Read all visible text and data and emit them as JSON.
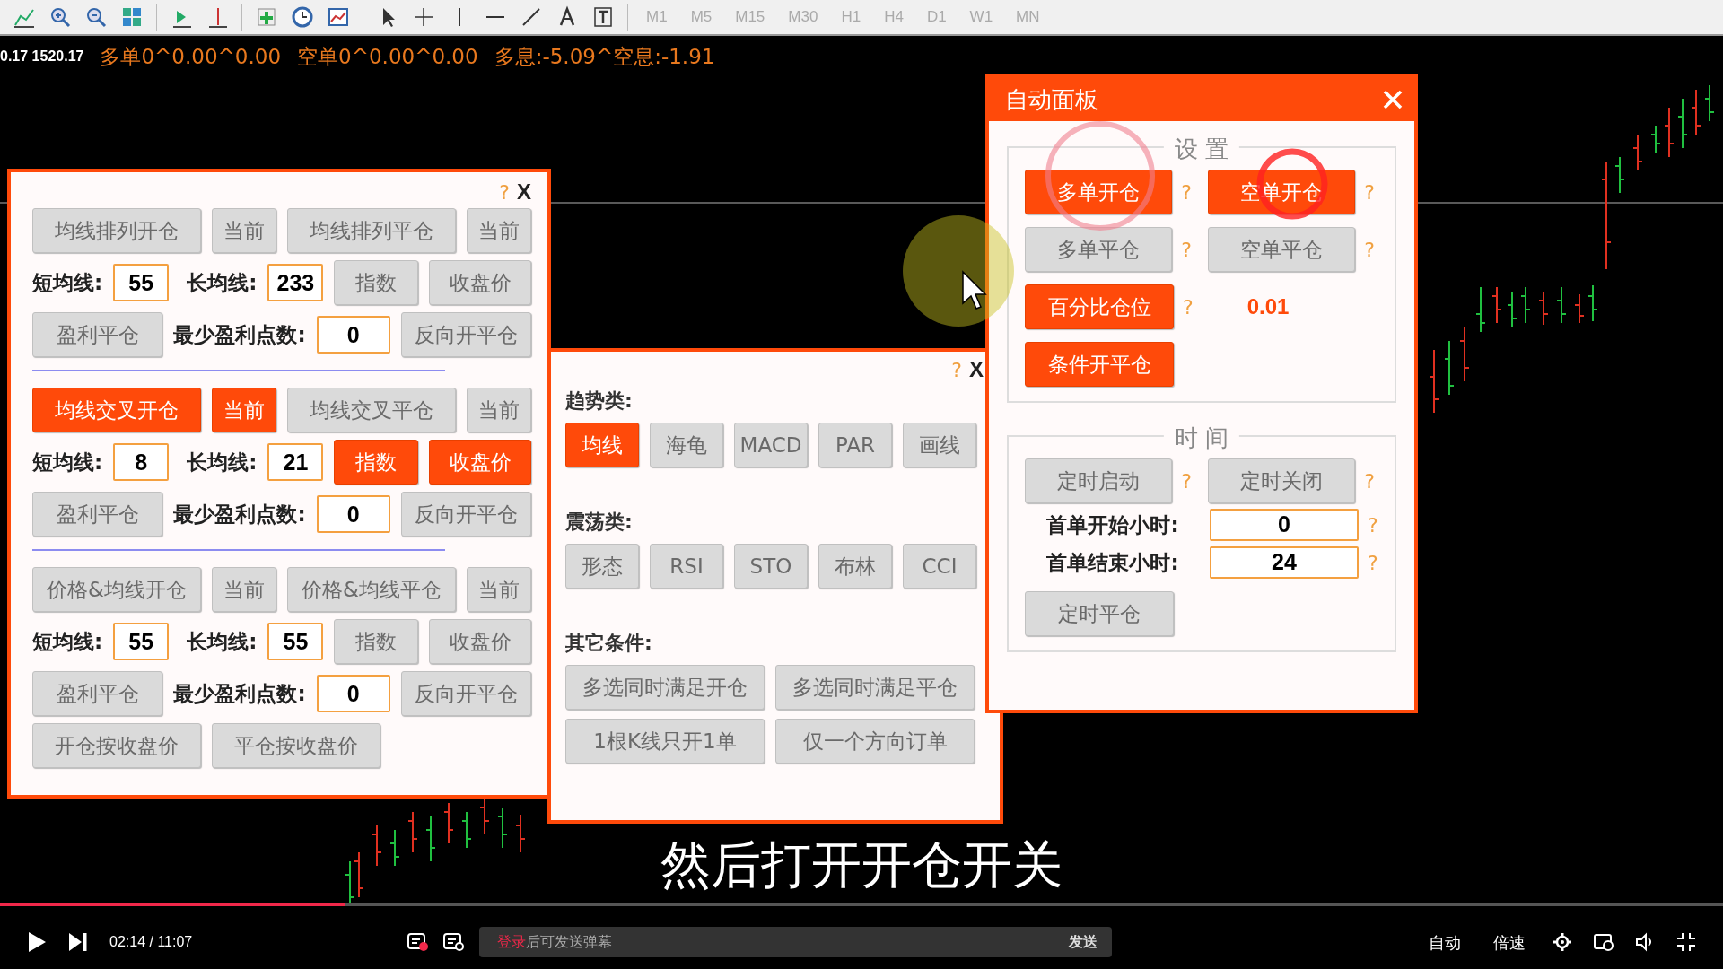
{
  "toolbar": {
    "timeframes": [
      {
        "label": "M1"
      },
      {
        "label": "M5"
      },
      {
        "label": "M15"
      },
      {
        "label": "M30"
      },
      {
        "label": "H1"
      },
      {
        "label": "H4"
      },
      {
        "label": "D1"
      },
      {
        "label": "W1"
      },
      {
        "label": "MN"
      }
    ]
  },
  "info_line": {
    "price": "0.17 1520.17",
    "items": [
      "多单0^0.00^0.00",
      "空单0^0.00^0.00",
      "多息:-5.09^空息:-1.91"
    ]
  },
  "ma_panel": {
    "help": "?",
    "close": "X",
    "sections": [
      {
        "open": {
          "label": "均线排列开仓",
          "on": false
        },
        "open_current": {
          "label": "当前",
          "on": false
        },
        "close": {
          "label": "均线排列平仓",
          "on": false
        },
        "close_current": {
          "label": "当前",
          "on": false
        },
        "short_label": "短均线:",
        "short_value": "55",
        "long_label": "长均线:",
        "long_value": "233",
        "ema": {
          "label": "指数",
          "on": false
        },
        "close_price": {
          "label": "收盘价",
          "on": false
        },
        "profit_close": {
          "label": "盈利平仓",
          "on": false
        },
        "min_profit_label": "最少盈利点数:",
        "min_profit_value": "0",
        "reverse": {
          "label": "反向开平仓",
          "on": false
        }
      },
      {
        "open": {
          "label": "均线交叉开仓",
          "on": true
        },
        "open_current": {
          "label": "当前",
          "on": true
        },
        "close": {
          "label": "均线交叉平仓",
          "on": false
        },
        "close_current": {
          "label": "当前",
          "on": false
        },
        "short_label": "短均线:",
        "short_value": "8",
        "long_label": "长均线:",
        "long_value": "21",
        "ema": {
          "label": "指数",
          "on": true
        },
        "close_price": {
          "label": "收盘价",
          "on": true
        },
        "profit_close": {
          "label": "盈利平仓",
          "on": false
        },
        "min_profit_label": "最少盈利点数:",
        "min_profit_value": "0",
        "reverse": {
          "label": "反向开平仓",
          "on": false
        }
      },
      {
        "open": {
          "label": "价格&均线开仓",
          "on": false
        },
        "open_current": {
          "label": "当前",
          "on": false
        },
        "close": {
          "label": "价格&均线平仓",
          "on": false
        },
        "close_current": {
          "label": "当前",
          "on": false
        },
        "short_label": "短均线:",
        "short_value": "55",
        "long_label": "长均线:",
        "long_value": "55",
        "ema": {
          "label": "指数",
          "on": false
        },
        "close_price": {
          "label": "收盘价",
          "on": false
        },
        "profit_close": {
          "label": "盈利平仓",
          "on": false
        },
        "min_profit_label": "最少盈利点数:",
        "min_profit_value": "0",
        "reverse": {
          "label": "反向开平仓",
          "on": false
        }
      }
    ],
    "footer_buttons": [
      {
        "label": "开仓按收盘价",
        "on": false
      },
      {
        "label": "平仓按收盘价",
        "on": false
      }
    ]
  },
  "signal_panel": {
    "help": "?",
    "close": "X",
    "groups": [
      {
        "kind": "options",
        "title": "趋势类:",
        "buttons": [
          {
            "label": "均线",
            "on": true
          },
          {
            "label": "海龟",
            "on": false
          },
          {
            "label": "MACD",
            "on": false
          },
          {
            "label": "PAR",
            "on": false
          },
          {
            "label": "画线",
            "on": false
          }
        ]
      },
      {
        "kind": "options",
        "title": "震荡类:",
        "buttons": [
          {
            "label": "形态",
            "on": false
          },
          {
            "label": "RSI",
            "on": false
          },
          {
            "label": "STO",
            "on": false
          },
          {
            "label": "布林",
            "on": false
          },
          {
            "label": "CCI",
            "on": false
          }
        ]
      },
      {
        "kind": "conditions",
        "title": "其它条件:",
        "buttons": [
          {
            "label": "多选同时满足开仓",
            "on": false
          },
          {
            "label": "多选同时满足平仓",
            "on": false
          },
          {
            "label": "1根K线只开1单",
            "on": false
          },
          {
            "label": "仅一个方向订单",
            "on": false
          }
        ]
      }
    ]
  },
  "auto_panel": {
    "title": "自动面板",
    "sections": [
      {
        "title": "设 置",
        "rows": [
          {
            "kind": "pair",
            "items": [
              {
                "label": "多单开仓",
                "on": true,
                "help": "?"
              },
              {
                "label": "空单开仓",
                "on": true,
                "help": "?"
              }
            ]
          },
          {
            "kind": "pair",
            "items": [
              {
                "label": "多单平仓",
                "on": false,
                "help": "?"
              },
              {
                "label": "空单平仓",
                "on": false,
                "help": "?"
              }
            ]
          },
          {
            "kind": "value",
            "button": {
              "label": "百分比仓位",
              "on": true,
              "help": "?"
            },
            "value": "0.01"
          },
          {
            "kind": "single",
            "button": {
              "label": "条件开平仓",
              "on": true
            }
          }
        ]
      },
      {
        "title": "时 间",
        "rows": [
          {
            "kind": "pair",
            "items": [
              {
                "label": "定时启动",
                "on": false,
                "help": "?"
              },
              {
                "label": "定时关闭",
                "on": false,
                "help": "?"
              }
            ]
          },
          {
            "kind": "field",
            "label": "首单开始小时:",
            "value": "0",
            "help": "?"
          },
          {
            "kind": "field",
            "label": "首单结束小时:",
            "value": "24",
            "help": "?"
          },
          {
            "kind": "single",
            "button": {
              "label": "定时平仓",
              "on": false
            }
          }
        ]
      }
    ]
  },
  "player": {
    "subtitle": "然后打开开仓开关",
    "progress": {
      "level": 0.2
    },
    "time": "02:14 / 11:07",
    "danmaku": {
      "login": "登录",
      "placeholder": "后可发送弹幕",
      "send": "发送"
    },
    "right_buttons": [
      "自动",
      "倍速"
    ]
  }
}
